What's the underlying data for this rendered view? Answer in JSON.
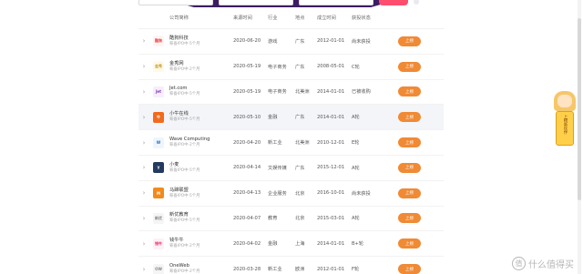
{
  "colors": {
    "accent": "#f08a35",
    "filter_button": "#ff4d6d",
    "hero": "#3b1d63",
    "row_highlight": "#f3f5f8"
  },
  "table": {
    "headers": {
      "company": "公司简称",
      "date": "来源时间",
      "industry": "行业",
      "location": "地点",
      "established": "成立时间",
      "stage": "获投状态"
    },
    "rows": [
      {
        "name": "酷狗科技",
        "sub": "筹备IPO中·5个月",
        "date": "2020-06-20",
        "industry": "游戏",
        "location": "广东",
        "est": "2012-01-01",
        "stage": "尚未获投",
        "logo_text": "酷狗",
        "logo_color": "#e23b3b",
        "logo_bg": "#fff3f3",
        "action": "上榜"
      },
      {
        "name": "金秀网",
        "sub": "筹备IPO中·2个月",
        "date": "2020-05-19",
        "industry": "电子商务",
        "location": "广东",
        "est": "2008-05-01",
        "stage": "C轮",
        "logo_text": "金秀",
        "logo_color": "#c79b1b",
        "logo_bg": "#fff9e8",
        "action": "上榜"
      },
      {
        "name": "Jet.com",
        "sub": "筹备IPO中·5个月",
        "date": "2020-05-19",
        "industry": "电子商务",
        "location": "北美洲",
        "est": "2014-01-01",
        "stage": "已被收购",
        "logo_text": "Jet",
        "logo_color": "#7b2fb3",
        "logo_bg": "#f6eefc",
        "action": "上榜"
      },
      {
        "name": "小牛在线",
        "sub": "筹备IPO中·5个月",
        "date": "2020-05-10",
        "industry": "金融",
        "location": "广东",
        "est": "2014-01-01",
        "stage": "A轮",
        "logo_text": "牛",
        "logo_color": "#ffffff",
        "logo_bg": "#f26b1d",
        "action": "上榜"
      },
      {
        "name": "Wave Computing",
        "sub": "筹备IPO中·2个月",
        "date": "2020-04-20",
        "industry": "新工业",
        "location": "北美洲",
        "est": "2010-12-01",
        "stage": "E轮",
        "logo_text": "W",
        "logo_color": "#1c6fb8",
        "logo_bg": "#eef5fc",
        "action": "上榜"
      },
      {
        "name": "小麦",
        "sub": "筹备IPO中·5个月",
        "date": "2020-04-14",
        "industry": "文娱传媒",
        "location": "广东",
        "est": "2015-12-01",
        "stage": "A轮",
        "logo_text": "Y",
        "logo_color": "#ffffff",
        "logo_bg": "#243a5e",
        "action": "上榜"
      },
      {
        "name": "马蹄联盟",
        "sub": "筹备IPO中·5个月",
        "date": "2020-04-13",
        "industry": "企业服务",
        "location": "北京",
        "est": "2016-10-01",
        "stage": "尚未获投",
        "logo_text": "M",
        "logo_color": "#ffffff",
        "logo_bg": "#f28a1c",
        "action": "上榜"
      },
      {
        "name": "新优教育",
        "sub": "筹备IPO中·5个月",
        "date": "2020-04-07",
        "industry": "教育",
        "location": "北京",
        "est": "2015-03-01",
        "stage": "A轮",
        "logo_text": "新优",
        "logo_color": "#888888",
        "logo_bg": "#f5f5f5",
        "action": "上榜"
      },
      {
        "name": "钱牛牛",
        "sub": "筹备IPO中·2个月",
        "date": "2020-04-02",
        "industry": "金融",
        "location": "上海",
        "est": "2014-01-01",
        "stage": "B+轮",
        "logo_text": "钱牛",
        "logo_color": "#e0245e",
        "logo_bg": "#fff0f5",
        "action": "上榜"
      },
      {
        "name": "OneWeb",
        "sub": "筹备IPO中·2个月",
        "date": "2020-03-28",
        "industry": "新工业",
        "location": "欧洲",
        "est": "2012-01-01",
        "stage": "F轮",
        "logo_text": "OW",
        "logo_color": "#888888",
        "logo_bg": "#f5f5f5",
        "action": "上榜"
      }
    ]
  },
  "side_widget": {
    "text": "上榜新伙伴"
  },
  "watermark": {
    "badge": "值",
    "text": "什么值得买"
  }
}
